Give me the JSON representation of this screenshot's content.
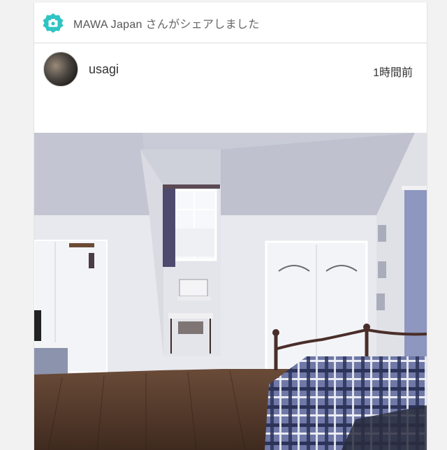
{
  "share": {
    "brand": "MAWA Japan",
    "suffix": "さんがシェアしました",
    "icon": "camera-icon",
    "accent": "#2fc4c4"
  },
  "post": {
    "username": "usagi",
    "time": "1時間前"
  },
  "photo": {
    "subject": "bedroom-interior"
  }
}
